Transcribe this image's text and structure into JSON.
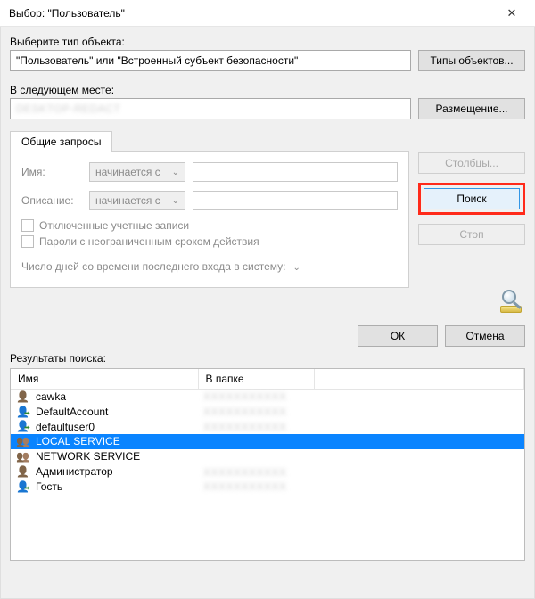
{
  "window": {
    "title": "Выбор: \"Пользователь\""
  },
  "objectType": {
    "label": "Выберите тип объекта:",
    "value": "\"Пользователь\" или \"Встроенный субъект безопасности\"",
    "button": "Типы объектов..."
  },
  "location": {
    "label": "В следующем месте:",
    "value": "DESKTOP-REDACT",
    "button": "Размещение..."
  },
  "tabs": {
    "common_queries": "Общие запросы"
  },
  "query": {
    "name_label": "Имя:",
    "desc_label": "Описание:",
    "starts_with": "начинается с",
    "chk_disabled": "Отключенные учетные записи",
    "chk_pwd_never_expires": "Пароли с неограниченным сроком действия",
    "last_login_label": "Число дней со времени последнего входа в систему:"
  },
  "side": {
    "columns": "Столбцы...",
    "search": "Поиск",
    "stop": "Стоп"
  },
  "dlg": {
    "ok": "ОК",
    "cancel": "Отмена"
  },
  "results": {
    "label": "Результаты поиска:",
    "col_name": "Имя",
    "col_folder": "В папке",
    "rows": [
      {
        "icon": "user",
        "name": "cawka",
        "folder": "XXXXXXXXXXX"
      },
      {
        "icon": "userarrow",
        "name": "DefaultAccount",
        "folder": "XXXXXXXXXXX"
      },
      {
        "icon": "userarrow",
        "name": "defaultuser0",
        "folder": "XXXXXXXXXXX"
      },
      {
        "icon": "users",
        "name": "LOCAL SERVICE",
        "folder": "",
        "selected": true
      },
      {
        "icon": "users",
        "name": "NETWORK SERVICE",
        "folder": ""
      },
      {
        "icon": "user",
        "name": "Администратор",
        "folder": "XXXXXXXXXXX"
      },
      {
        "icon": "userarrow",
        "name": "Гость",
        "folder": "XXXXXXXXXXX"
      }
    ]
  }
}
